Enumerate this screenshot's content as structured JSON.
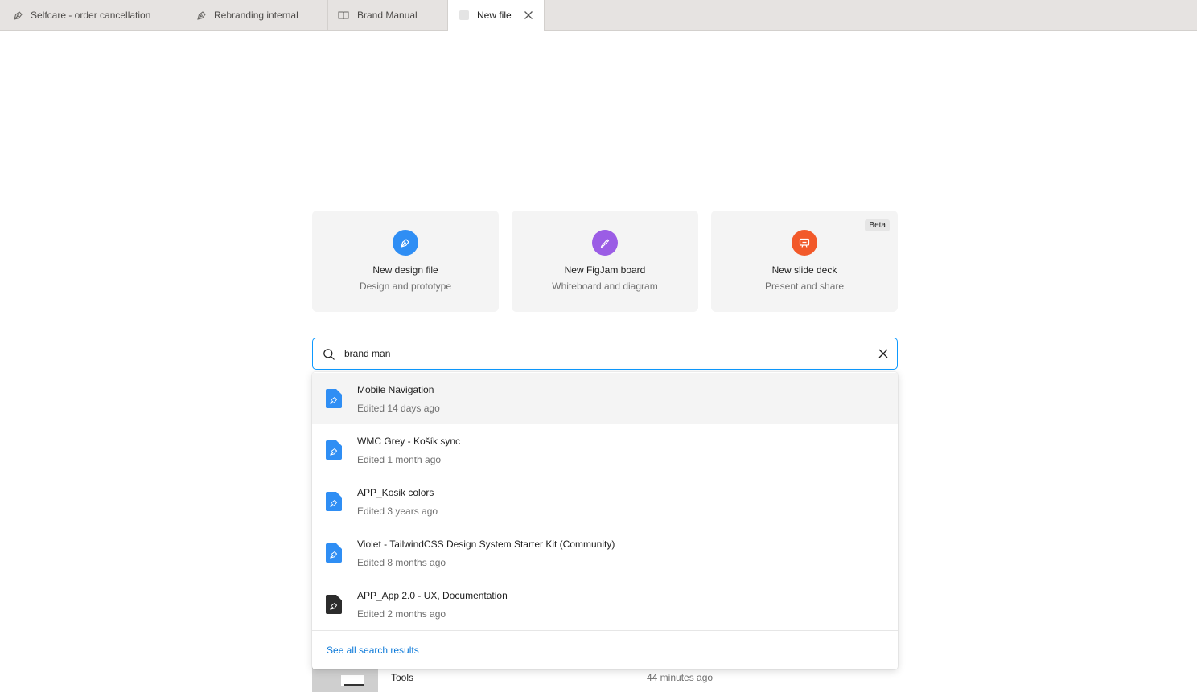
{
  "tabs": [
    {
      "label": "Selfcare - order cancellation",
      "icon": "pen-icon"
    },
    {
      "label": "Rebranding internal",
      "icon": "pen-icon"
    },
    {
      "label": "Brand Manual",
      "icon": "book-icon"
    },
    {
      "label": "New file",
      "icon": "blank-file-icon",
      "active": true
    }
  ],
  "cards": [
    {
      "title": "New design file",
      "subtitle": "Design and prototype",
      "color": "#2f8ef4",
      "icon": "pen-icon"
    },
    {
      "title": "New FigJam board",
      "subtitle": "Whiteboard and diagram",
      "color": "#9b5de5",
      "icon": "marker-icon"
    },
    {
      "title": "New slide deck",
      "subtitle": "Present and share",
      "color": "#f2592a",
      "icon": "presentation-icon",
      "badge": "Beta"
    }
  ],
  "search": {
    "value": "brand man"
  },
  "results": [
    {
      "name": "Mobile Navigation",
      "edited": "Edited 14 days ago",
      "icon_color": "#2f8ef4"
    },
    {
      "name": "WMC Grey - Košík sync",
      "edited": "Edited 1 month ago",
      "icon_color": "#2f8ef4"
    },
    {
      "name": "APP_Kosik colors",
      "edited": "Edited 3 years ago",
      "icon_color": "#2f8ef4"
    },
    {
      "name": "Violet - TailwindCSS Design System Starter Kit (Community)",
      "edited": "Edited 8 months ago",
      "icon_color": "#2f8ef4"
    },
    {
      "name": "APP_App 2.0 - UX, Documentation",
      "edited": "Edited 2 months ago",
      "icon_color": "#2c2c2c"
    }
  ],
  "see_all": "See all search results",
  "background_row": {
    "name": "Tools",
    "time": "44 minutes ago"
  }
}
